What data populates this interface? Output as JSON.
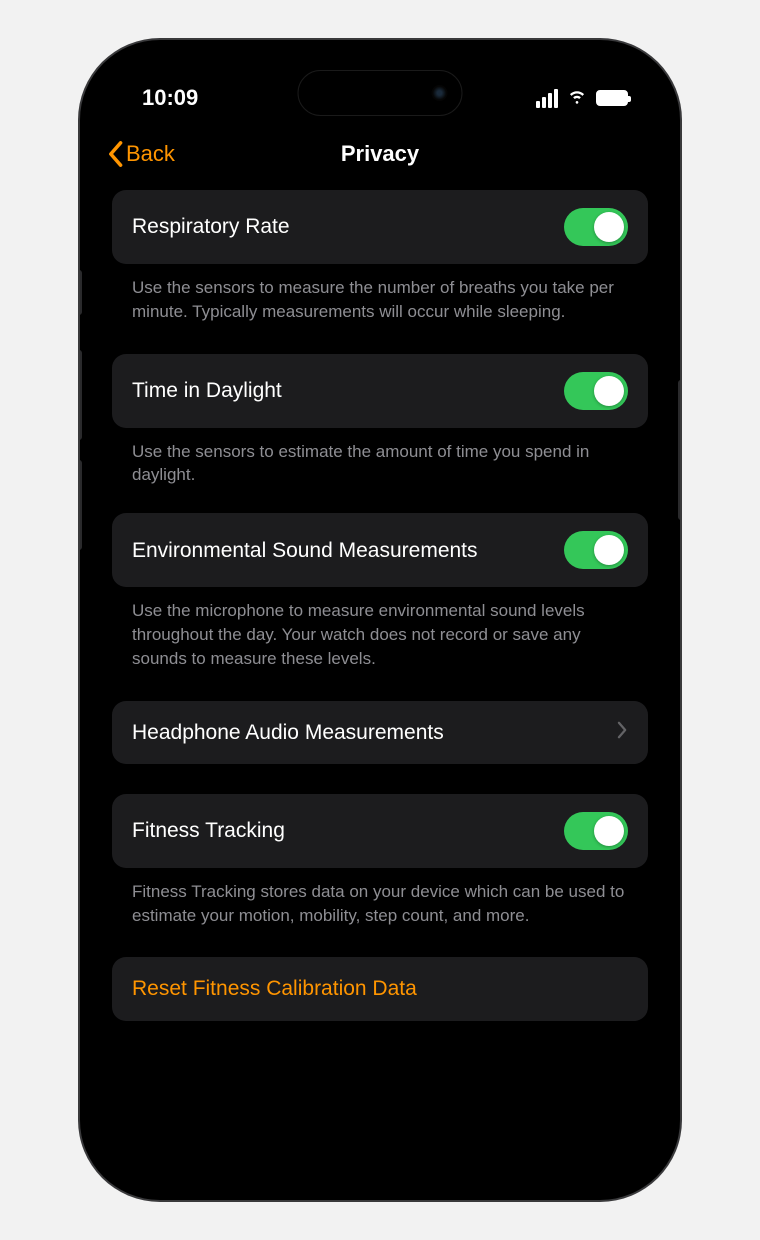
{
  "status": {
    "time": "10:09"
  },
  "nav": {
    "back": "Back",
    "title": "Privacy"
  },
  "rows": {
    "respiratory": {
      "label": "Respiratory Rate",
      "footer": "Use the sensors to measure the number of breaths you take per minute. Typically measurements will occur while sleeping.",
      "on": true
    },
    "daylight": {
      "label": "Time in Daylight",
      "footer": "Use the sensors to estimate the amount of time you spend in daylight.",
      "on": true
    },
    "envsound": {
      "label": "Environmental Sound Measurements",
      "footer": "Use the microphone to measure environmental sound levels throughout the day. Your watch does not record or save any sounds to measure these levels.",
      "on": true
    },
    "headphone": {
      "label": "Headphone Audio Measurements"
    },
    "fitness": {
      "label": "Fitness Tracking",
      "footer": "Fitness Tracking stores data on your device which can be used to estimate your motion, mobility, step count, and more.",
      "on": true
    },
    "reset": {
      "label": "Reset Fitness Calibration Data"
    }
  },
  "colors": {
    "accent": "#ff9500",
    "toggle_on": "#34c759",
    "cell_bg": "#1c1c1e",
    "footer_text": "#8e8e93"
  }
}
